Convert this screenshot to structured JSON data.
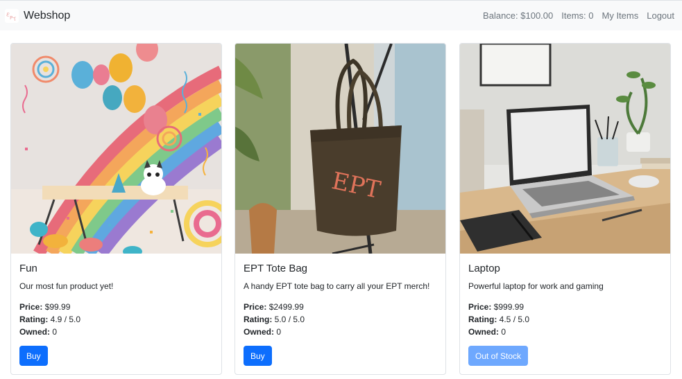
{
  "navbar": {
    "brand": "Webshop",
    "logo_text": "EPT",
    "balance": "Balance: $100.00",
    "items": "Items: 0",
    "my_items": "My Items",
    "logout": "Logout"
  },
  "labels": {
    "price": "Price:",
    "rating": "Rating:",
    "owned": "Owned:"
  },
  "products": [
    {
      "title": "Fun",
      "description": "Our most fun product yet!",
      "price": "$99.99",
      "rating": "4.9 / 5.0",
      "owned": "0",
      "button": "Buy",
      "button_enabled": true
    },
    {
      "title": "EPT Tote Bag",
      "description": "A handy EPT tote bag to carry all your EPT merch!",
      "price": "$2499.99",
      "rating": "5.0 / 5.0",
      "owned": "0",
      "button": "Buy",
      "button_enabled": true,
      "bag_text": "EPT"
    },
    {
      "title": "Laptop",
      "description": "Powerful laptop for work and gaming",
      "price": "$999.99",
      "rating": "4.5 / 5.0",
      "owned": "0",
      "button": "Out of Stock",
      "button_enabled": false
    }
  ],
  "colors": {
    "primary": "#0d6efd",
    "disabled": "#6ea8fe",
    "navbar_bg": "#f8f9fa",
    "nav_text": "#6c757d"
  }
}
